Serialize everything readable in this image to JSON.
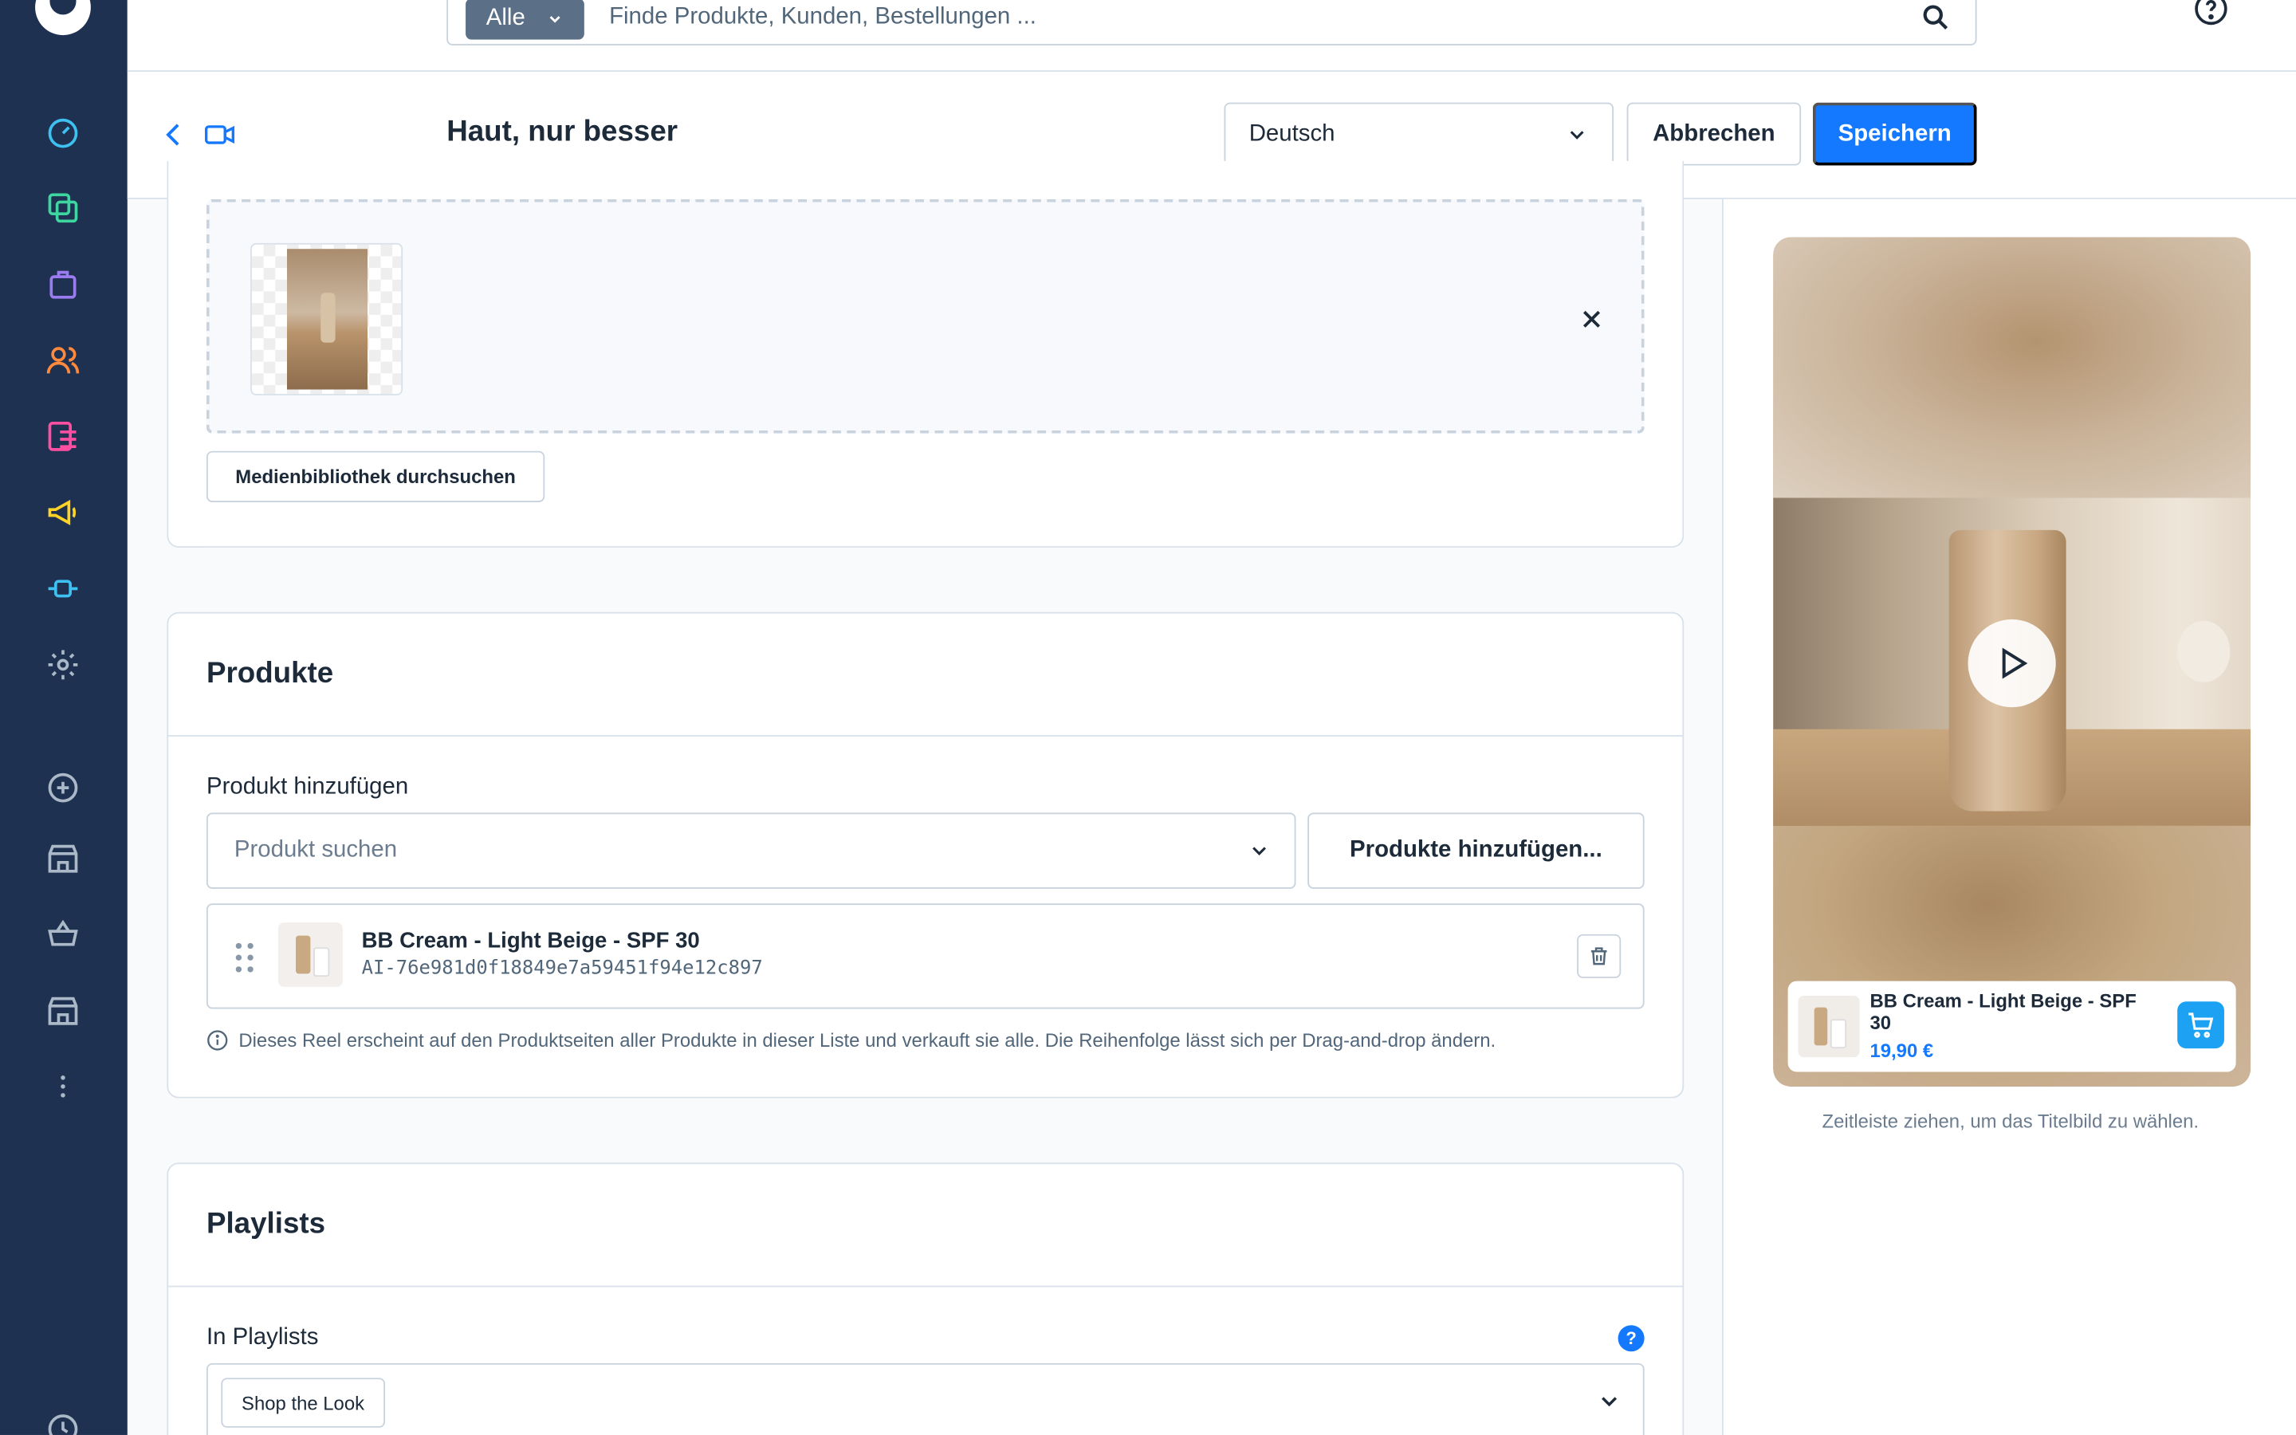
{
  "colors": {
    "sidebar_bg": "#1e3150",
    "accent": "#1479ff",
    "border": "#d9e1ea",
    "text": "#1c2a3a",
    "muted": "#52667a"
  },
  "sidebar": {
    "items": [
      {
        "icon": "dashboard-icon",
        "color": "#3ec1f0"
      },
      {
        "icon": "catalog-icon",
        "color": "#3ed6a0"
      },
      {
        "icon": "orders-bag-icon",
        "color": "#9b7cf0"
      },
      {
        "icon": "customers-icon",
        "color": "#ff8a3d"
      },
      {
        "icon": "content-icon",
        "color": "#ff4fa3"
      },
      {
        "icon": "marketing-megaphone-icon",
        "color": "#ffd426"
      },
      {
        "icon": "extensions-plug-icon",
        "color": "#3ec1f0"
      },
      {
        "icon": "settings-gear-icon",
        "color": "#aab8c8"
      },
      {
        "icon": "add-sales-channel-icon",
        "color": "#aab8c8"
      },
      {
        "icon": "storefront-icon",
        "color": "#aab8c8"
      },
      {
        "icon": "basket-icon",
        "color": "#aab8c8"
      },
      {
        "icon": "storefront-2-icon",
        "color": "#aab8c8"
      },
      {
        "icon": "more-icon",
        "color": "#aab8c8"
      }
    ]
  },
  "search": {
    "scope_label": "Alle",
    "placeholder": "Finde Produkte, Kunden, Bestellungen ..."
  },
  "header": {
    "title": "Haut, nur besser",
    "language": "Deutsch",
    "cancel_label": "Abbrechen",
    "save_label": "Speichern"
  },
  "media": {
    "library_button": "Medienbibliothek durchsuchen"
  },
  "products": {
    "title": "Produkte",
    "add_label": "Produkt hinzufügen",
    "select_placeholder": "Produkt suchen",
    "add_button": "Produkte hinzufügen...",
    "items": [
      {
        "name": "BB Cream - Light Beige - SPF 30",
        "sku": "AI-76e981d0f18849e7a59451f94e12c897"
      }
    ],
    "hint": "Dieses Reel erscheint auf den Produktseiten aller Produkte in dieser Liste und verkauft sie alle. Die Reihenfolge lässt sich per Drag-and-drop ändern."
  },
  "playlists": {
    "title": "Playlists",
    "label": "In Playlists",
    "help": "?",
    "selected": [
      "Shop the Look"
    ]
  },
  "preview": {
    "product_name": "BB Cream - Light Beige - SPF 30",
    "price": "19,90 €",
    "hint": "Zeitleiste ziehen, um das Titelbild zu wählen."
  }
}
